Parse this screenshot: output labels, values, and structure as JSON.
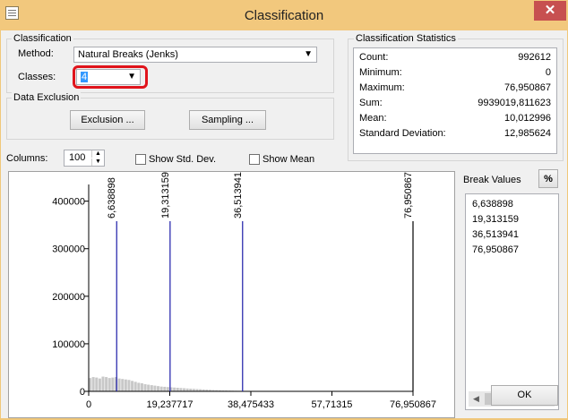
{
  "window": {
    "title": "Classification",
    "close_glyph": "✕"
  },
  "classification": {
    "group_label": "Classification",
    "method_label": "Method:",
    "method_value": "Natural Breaks (Jenks)",
    "classes_label": "Classes:",
    "classes_value": "4"
  },
  "exclusion": {
    "group_label": "Data Exclusion",
    "exclusion_button": "Exclusion ...",
    "sampling_button": "Sampling ..."
  },
  "stats": {
    "group_label": "Classification Statistics",
    "rows": [
      {
        "label": "Count:",
        "value": "992612"
      },
      {
        "label": "Minimum:",
        "value": "0"
      },
      {
        "label": "Maximum:",
        "value": "76,950867"
      },
      {
        "label": "Sum:",
        "value": "9939019,811623"
      },
      {
        "label": "Mean:",
        "value": "10,012996"
      },
      {
        "label": "Standard Deviation:",
        "value": "12,985624"
      }
    ]
  },
  "options": {
    "columns_label": "Columns:",
    "columns_value": "100",
    "show_std_label": "Show Std. Dev.",
    "show_mean_label": "Show Mean"
  },
  "break_values": {
    "label": "Break Values",
    "percent_button": "%",
    "values": [
      "6,638898",
      "19,313159",
      "36,513941",
      "76,950867"
    ]
  },
  "ok_button": "OK",
  "chart_data": {
    "type": "bar",
    "xlim": [
      0,
      76.950867
    ],
    "ylim": [
      0,
      420000
    ],
    "x_tick_labels": [
      "0",
      "19,237717",
      "38,475433",
      "57,71315",
      "76,950867"
    ],
    "x_tick_values": [
      0,
      19.237717,
      38.475433,
      57.71315,
      76.950867
    ],
    "y_tick_labels": [
      "400000",
      "300000",
      "200000",
      "100000",
      "0"
    ],
    "y_tick_values": [
      400000,
      300000,
      200000,
      100000,
      0
    ],
    "break_labels": [
      "6,638898",
      "19,313159",
      "36,513941",
      "76,950867"
    ],
    "break_values": [
      6.638898,
      19.313159,
      36.513941,
      76.950867
    ],
    "bins": [
      28000,
      30000,
      29000,
      27000,
      31000,
      30000,
      28000,
      29000,
      30000,
      27000,
      26000,
      25000,
      24000,
      22000,
      20000,
      18000,
      17000,
      15000,
      14000,
      13000,
      12000,
      11000,
      10000,
      9500,
      9000,
      8500,
      8000,
      7500,
      7000,
      6500,
      6000,
      5600,
      5200,
      4800,
      4400,
      4000,
      3600,
      3200,
      2900,
      2600,
      2300,
      2000,
      1800,
      1600,
      1400,
      1200,
      1100,
      1000,
      900,
      800,
      700,
      650,
      600,
      550,
      500,
      450,
      400,
      380,
      360,
      340,
      320,
      300,
      280,
      260,
      240,
      220,
      200,
      190,
      180,
      170,
      160,
      150,
      140,
      130,
      120,
      110,
      100,
      95,
      90,
      85,
      80,
      75,
      70,
      65,
      60,
      55,
      50,
      45,
      40,
      36,
      32,
      28,
      24,
      20,
      18,
      16,
      14,
      12,
      10,
      8
    ],
    "bar_color": "#c8c8c8",
    "break_color": "#1c1ca8"
  }
}
